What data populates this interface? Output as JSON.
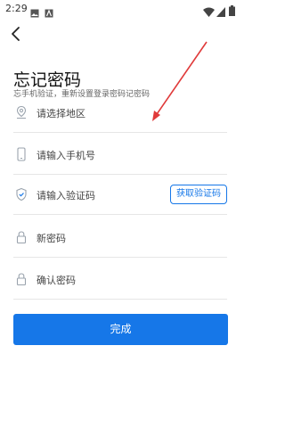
{
  "status": {
    "time": "2:29"
  },
  "page": {
    "title": "忘记密码",
    "subtitle": "忘手机验证，重新设置登录密码记密码"
  },
  "fields": {
    "region": {
      "placeholder": "请选择地区"
    },
    "phone": {
      "placeholder": "请输入手机号"
    },
    "code": {
      "placeholder": "请输入验证码",
      "button": "获取验证码"
    },
    "new_password": {
      "placeholder": "新密码"
    },
    "confirm_password": {
      "placeholder": "确认密码"
    }
  },
  "submit": {
    "label": "完成"
  },
  "colors": {
    "accent": "#1677e8",
    "annotation": "#e03a3a"
  },
  "icons": [
    "back-arrow-icon",
    "location-pin-icon",
    "phone-icon",
    "shield-check-icon",
    "lock-icon"
  ]
}
